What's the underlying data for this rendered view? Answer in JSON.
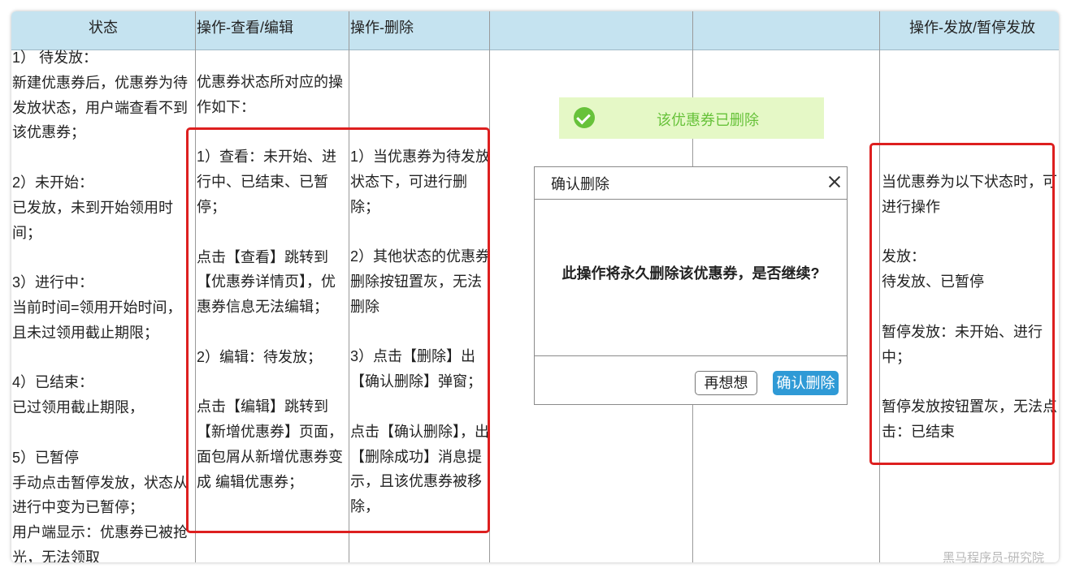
{
  "table": {
    "headers": [
      "状态",
      "操作-查看/编辑",
      "操作-删除",
      "",
      "",
      "操作-发放/暂停发放"
    ],
    "status_col": "1） 待发放：\n新建优惠券后，优惠券为待发放状态，用户端查看不到该优惠券；\n\n2）未开始：\n已发放，未到开始领用时间；\n\n3）进行中：\n当前时间=领用开始时间，且未过领用截止期限；\n\n4）已结束：\n已过领用截止期限，\n\n5）已暂停\n手动点击暂停发放，状态从进行中变为已暂停；\n用户端显示：优惠券已被抢光，无法领取",
    "view_edit_col": "优惠券状态所对应的操作如下：\n\n1）查看：未开始、进行中、已结束、已暂停；\n\n点击【查看】跳转到【优惠券详情页】，优惠券信息无法编辑；\n\n2）编辑：待发放；\n\n点击【编辑】跳转到【新增优惠券】页面，面包屑从新增优惠券变成 编辑优惠券；",
    "delete_col": "1）当优惠券为待发放状态下，可进行删除；\n\n2）其他状态的优惠券删除按钮置灰，无法删除\n\n3）点击【删除】出【确认删除】弹窗；\n\n点击【确认删除】，出【删除成功】消息提示，且该优惠券被移除，",
    "issue_col": "当优惠券为以下状态时，可进行操作\n\n发放：\n待发放、已暂停\n\n暂停发放：未开始、进行中；\n\n暂停发放按钮置灰，无法点击：已结束"
  },
  "toast": {
    "icon": "check-circle-icon",
    "message": "该优惠券已删除",
    "color": "#67c23a",
    "background": "#e5f8c6"
  },
  "dialog": {
    "title": "确认删除",
    "close_icon": "close-icon",
    "message": "此操作将永久删除该优惠券，是否继续?",
    "cancel_label": "再想想",
    "confirm_label": "确认删除",
    "confirm_color": "#2f9ad6"
  },
  "colors": {
    "header_bg": "#c5e3f0",
    "highlight_border": "#dd1f1f"
  },
  "watermark": "黑马程序员-研究院"
}
